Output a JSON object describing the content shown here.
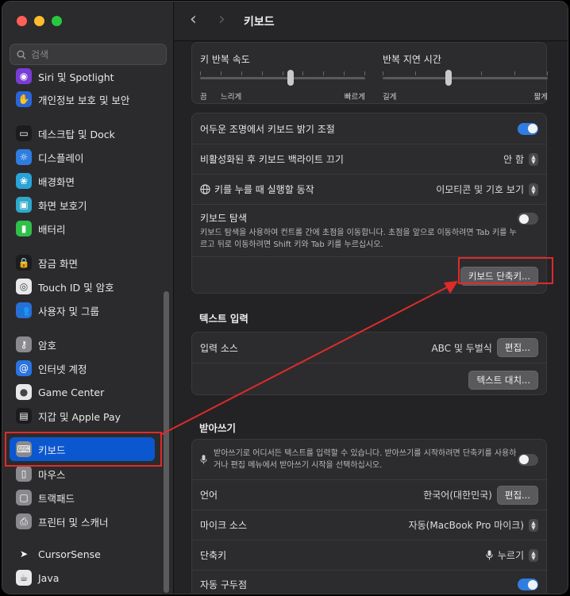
{
  "sidebar": {
    "search_placeholder": "검색",
    "items": [
      {
        "label": "Siri 및 Spotlight",
        "icon": "siri-icon",
        "color": "#7a3cd6"
      },
      {
        "label": "개인정보 보호 및 보안",
        "icon": "hand-icon",
        "color": "#2a66d8"
      },
      {
        "label": "데스크탑 및 Dock",
        "icon": "dock-icon",
        "color": "#1c1c1e"
      },
      {
        "label": "디스플레이",
        "icon": "sun-icon",
        "color": "#2e7de0"
      },
      {
        "label": "배경화면",
        "icon": "flower-icon",
        "color": "#2aa3d8"
      },
      {
        "label": "화면 보호기",
        "icon": "screensaver-icon",
        "color": "#2ea9c9"
      },
      {
        "label": "배터리",
        "icon": "battery-icon",
        "color": "#2fbf4a"
      },
      {
        "label": "잠금 화면",
        "icon": "lock-icon",
        "color": "#1c1c1e"
      },
      {
        "label": "Touch ID 및 암호",
        "icon": "fingerprint-icon",
        "color": "#e8e8ea"
      },
      {
        "label": "사용자 및 그룹",
        "icon": "users-icon",
        "color": "#2a6fd8"
      },
      {
        "label": "암호",
        "icon": "key-icon",
        "color": "#8a8a8e"
      },
      {
        "label": "인터넷 계정",
        "icon": "at-icon",
        "color": "#2a73e0"
      },
      {
        "label": "Game Center",
        "icon": "gamecenter-icon",
        "color": "#e8e8ea"
      },
      {
        "label": "지갑 및 Apple Pay",
        "icon": "wallet-icon",
        "color": "#1c1c1e"
      },
      {
        "label": "키보드",
        "icon": "keyboard-icon",
        "color": "#8a8a8e"
      },
      {
        "label": "마우스",
        "icon": "mouse-icon",
        "color": "#8a8a8e"
      },
      {
        "label": "트랙패드",
        "icon": "trackpad-icon",
        "color": "#8a8a8e"
      },
      {
        "label": "프린터 및 스캐너",
        "icon": "printer-icon",
        "color": "#8a8a8e"
      },
      {
        "label": "CursorSense",
        "icon": "cursorsense-icon",
        "color": "#2b2b2d"
      },
      {
        "label": "Java",
        "icon": "java-icon",
        "color": "#e8e8ea"
      }
    ]
  },
  "header": {
    "title": "키보드",
    "back": "‹",
    "forward": "›"
  },
  "sliders": {
    "repeat_rate": {
      "title": "키 반복 속도",
      "left": "끔",
      "mid": "느리게",
      "right": "빠르게",
      "level": 0.55,
      "ticks": 9
    },
    "repeat_delay": {
      "title": "반복 지연 시간",
      "left": "길게",
      "right": "짧게",
      "level": 0.4,
      "ticks": 6
    }
  },
  "settings": {
    "brightness_label": "어두운 조명에서 키보드 밝기 조절",
    "backlight_off_label": "비활성화된 후 키보드 백라이트 끄기",
    "backlight_off_value": "안 함",
    "globe_label": "키를 누를 때 실행할 동작",
    "globe_value": "이모티콘 및 기호 보기",
    "nav_label": "키보드 탐색",
    "nav_desc": "키보드 탐색을 사용하여 컨트롤 간에 초점을 이동합니다. 초점을 앞으로 이동하려면 Tab 키를 누르고 뒤로 이동하려면 Shift 키와 Tab 키를 누르십시오.",
    "shortcuts_button": "키보드 단축키..."
  },
  "text_input": {
    "section_title": "텍스트 입력",
    "source_label": "입력 소스",
    "source_value": "ABC 및 두벌식",
    "edit_button": "편집...",
    "replace_button": "텍스트 대치..."
  },
  "dictation": {
    "section_title": "받아쓰기",
    "desc": "받아쓰기로 어디서든 텍스트를 입력할 수 있습니다. 받아쓰기를 시작하려면 단축키를 사용하거나 편집 메뉴에서 받아쓰기 시작을 선택하십시오.",
    "language_label": "언어",
    "language_value": "한국어(대한민국)",
    "edit_button": "편집...",
    "mic_label": "마이크 소스",
    "mic_value": "자동(MacBook Pro 마이크)",
    "shortcut_label": "단축키",
    "shortcut_value": "누르기",
    "punct_label": "자동 구두점"
  },
  "colors": {
    "accent": "#2f7de1",
    "annotation": "#e02a2a",
    "selection": "#0b57d0"
  }
}
